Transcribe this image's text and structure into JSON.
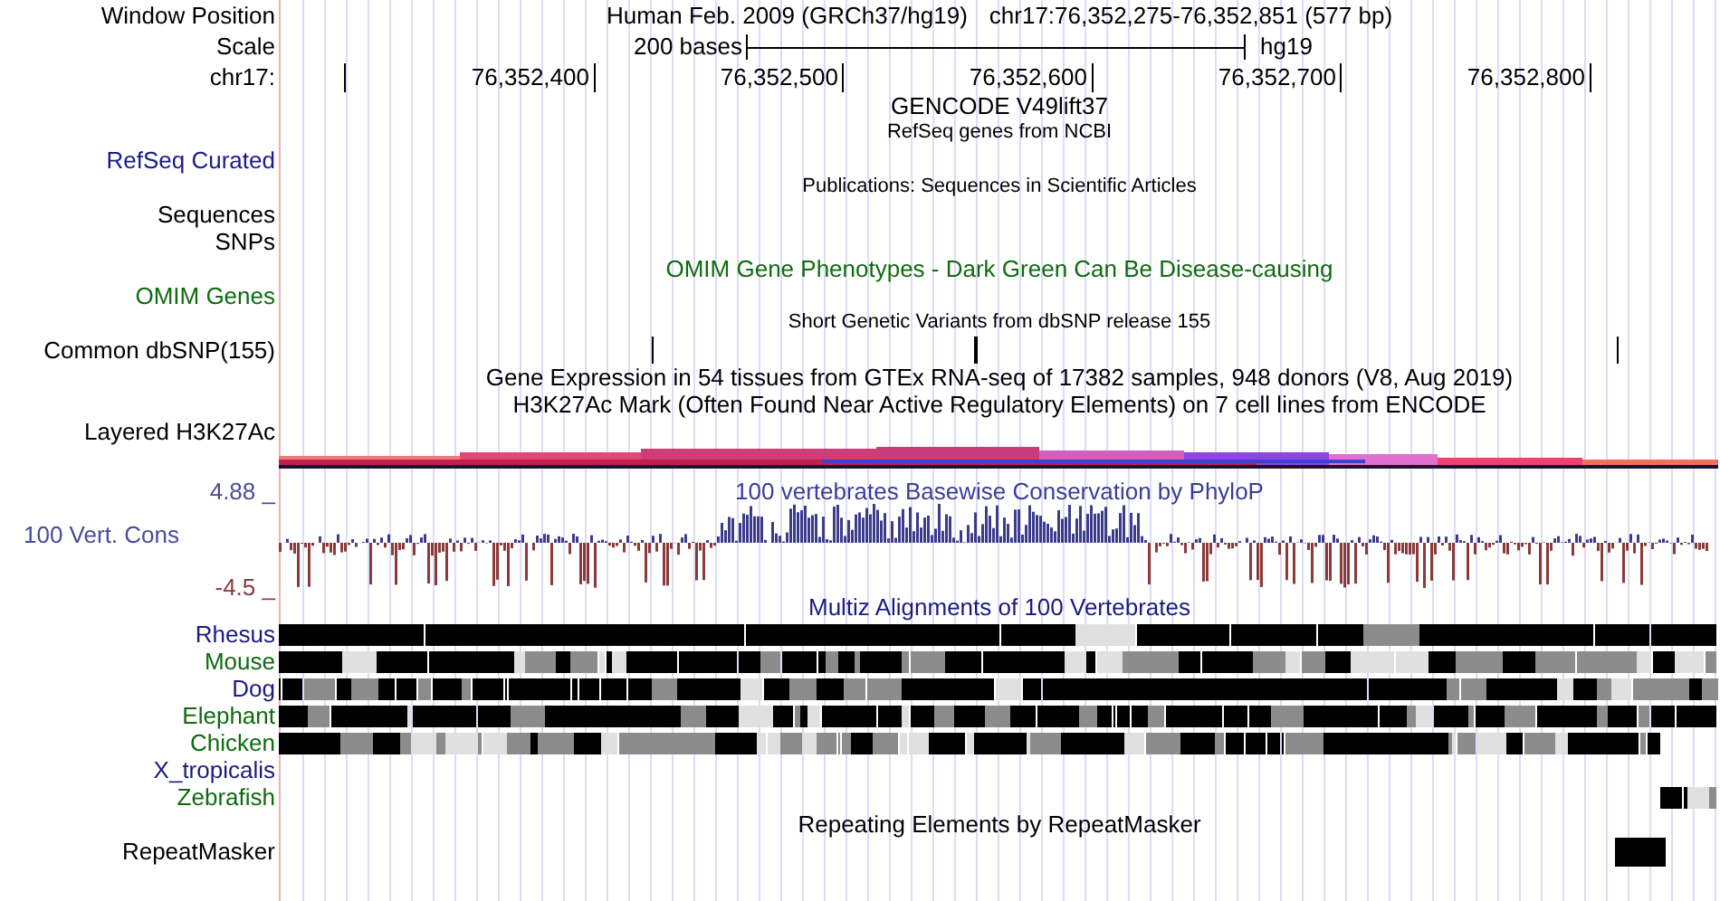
{
  "window_position": {
    "label": "Window Position",
    "assembly": "Human Feb. 2009 (GRCh37/hg19)",
    "position": "chr17:76,352,275-76,352,851 (577 bp)"
  },
  "scale": {
    "label": "Scale",
    "length": "200 bases",
    "assembly": "hg19"
  },
  "ruler": {
    "label": "chr17:",
    "ticks": [
      "76,352,400",
      "76,352,500",
      "76,352,600",
      "76,352,700",
      "76,352,800"
    ]
  },
  "tracks": [
    {
      "kind": "title",
      "text": "GENCODE V49lift37",
      "color": "#000000"
    },
    {
      "kind": "caption",
      "text": "RefSeq genes from NCBI"
    },
    {
      "kind": "label",
      "label": "RefSeq Curated",
      "color": "#1a1a8c"
    },
    {
      "kind": "caption",
      "text": "Publications: Sequences in Scientific Articles"
    },
    {
      "kind": "label",
      "label": "Sequences",
      "color": "#000000"
    },
    {
      "kind": "label",
      "label": "SNPs",
      "color": "#000000"
    },
    {
      "kind": "title",
      "text": "OMIM Gene Phenotypes - Dark Green Can Be Disease-causing",
      "color": "#0f6b0f"
    },
    {
      "kind": "label",
      "label": "OMIM Genes",
      "color": "#0f6b0f"
    },
    {
      "kind": "caption",
      "text": "Short Genetic Variants from dbSNP release 155"
    },
    {
      "kind": "snps",
      "label": "Common dbSNP(155)",
      "color": "#000000"
    },
    {
      "kind": "title",
      "text": "Gene Expression in 54 tissues from GTEx RNA-seq of 17382 samples, 948 donors (V8, Aug 2019)",
      "color": "#000000"
    },
    {
      "kind": "title",
      "text": "H3K27Ac Mark (Often Found Near Active Regulatory Elements) on 7 cell lines from ENCODE",
      "color": "#000000"
    },
    {
      "kind": "label",
      "label": "Layered H3K27Ac",
      "color": "#000000"
    },
    {
      "kind": "bands"
    },
    {
      "kind": "wiggle",
      "label": "100 Vert. Cons",
      "max": "4.88 _",
      "min": "-4.5 _",
      "text": "100 vertebrates Basewise Conservation by PhyloP"
    },
    {
      "kind": "title",
      "text": "Multiz Alignments of 100 Vertebrates",
      "color": "#1a1a80"
    },
    {
      "kind": "alignment",
      "label": "Rhesus",
      "color": "#1a1a80"
    },
    {
      "kind": "alignment",
      "label": "Mouse",
      "color": "#0f6b0f"
    },
    {
      "kind": "alignment",
      "label": "Dog",
      "color": "#1a1a80"
    },
    {
      "kind": "alignment",
      "label": "Elephant",
      "color": "#0f6b0f"
    },
    {
      "kind": "alignment",
      "label": "Chicken",
      "color": "#0f6b0f"
    },
    {
      "kind": "alignment",
      "label": "X_tropicalis",
      "color": "#1a1a80"
    },
    {
      "kind": "alignment",
      "label": "Zebrafish",
      "color": "#0f6b0f"
    },
    {
      "kind": "title",
      "text": "Repeating Elements by RepeatMasker",
      "color": "#000000"
    },
    {
      "kind": "repeats",
      "label": "RepeatMasker",
      "color": "#000000"
    }
  ]
}
